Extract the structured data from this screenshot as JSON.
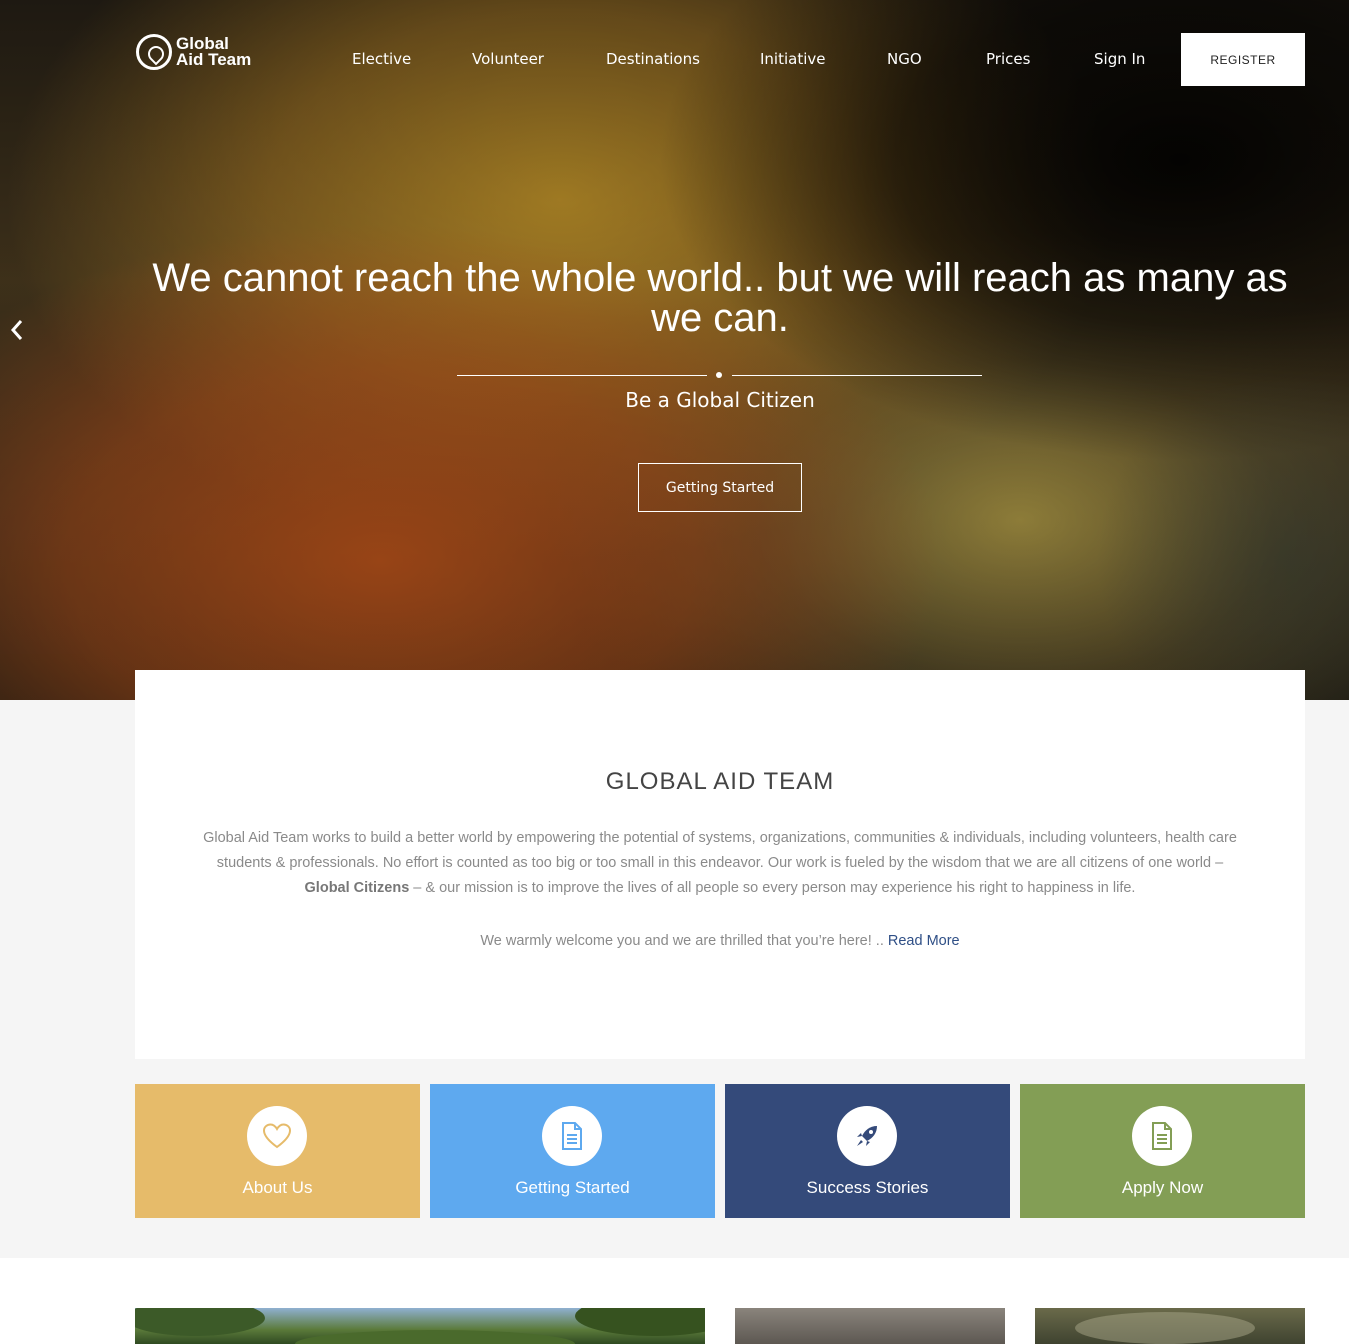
{
  "brand": {
    "line1": "Global",
    "line2": "Aid Team"
  },
  "nav": {
    "items": [
      "Elective",
      "Volunteer",
      "Destinations",
      "Initiative",
      "NGO",
      "Prices",
      "Sign In"
    ],
    "register": "REGISTER"
  },
  "hero": {
    "headline": "We cannot reach the whole world.. but we will reach as many as we can.",
    "subline": "Be a Global Citizen",
    "cta": "Getting Started"
  },
  "about": {
    "title": "GLOBAL AID TEAM",
    "body_before": "Global Aid Team works to build a better world by empowering the potential of systems, organizations, communities & individuals, including volunteers, health care students & professionals. No effort is counted as too big or too small in this endeavor. Our work is fueled by the wisdom that we are all citizens of one world – ",
    "body_bold": "Global Citizens",
    "body_after": " – & our mission is to improve the lives of all people so every person may experience his right to happiness in life.",
    "welcome": "We warmly welcome you and we are thrilled that you’re here! ..",
    "read_more": " Read More"
  },
  "tiles": [
    {
      "label": "About Us",
      "icon": "heart-icon",
      "color": "#e6bb6a"
    },
    {
      "label": "Getting Started",
      "icon": "document-icon",
      "color": "#5ea9ef"
    },
    {
      "label": "Success Stories",
      "icon": "rocket-icon",
      "color": "#344a7a"
    },
    {
      "label": "Apply Now",
      "icon": "document-icon",
      "color": "#839e55"
    }
  ],
  "colors": {
    "link": "#2f4f86",
    "page_bg": "#f5f5f5"
  }
}
